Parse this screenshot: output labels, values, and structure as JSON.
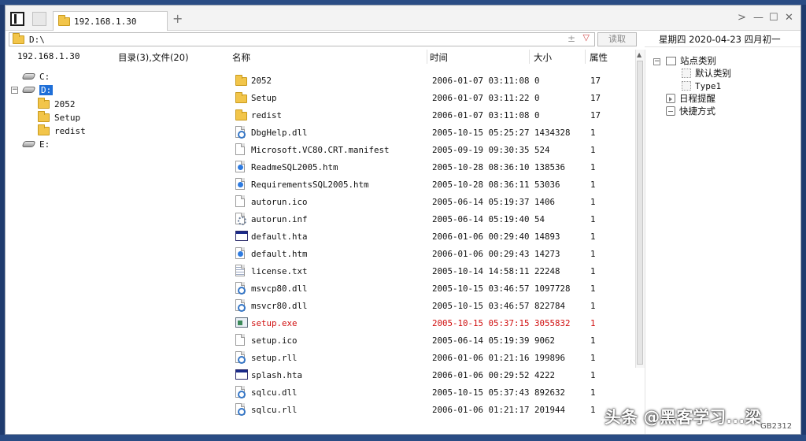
{
  "tab": {
    "label": "192.168.1.30"
  },
  "toolbar": {
    "new_tab": "+",
    "forward": ">",
    "minimize": "—",
    "maximize": "☐",
    "close": "✕"
  },
  "address": {
    "value": "D:\\",
    "add": "±",
    "dropdown": "▽",
    "read_button": "读取"
  },
  "date_bar": {
    "text": "星期四 2020-04-23  四月初一"
  },
  "left_pane": {
    "host": "192.168.1.30",
    "summary": "目录(3),文件(20)",
    "drives": [
      "C:",
      "D:",
      "E:"
    ],
    "d_folders": [
      "2052",
      "Setup",
      "redist"
    ]
  },
  "columns": {
    "name": "名称",
    "time": "时间",
    "size": "大小",
    "attr": "属性"
  },
  "files": [
    {
      "icon": "folder",
      "name": "2052",
      "time": "2006-01-07 03:11:08",
      "size": "0",
      "attr": "17"
    },
    {
      "icon": "folder",
      "name": "Setup",
      "time": "2006-01-07 03:11:22",
      "size": "0",
      "attr": "17"
    },
    {
      "icon": "folder",
      "name": "redist",
      "time": "2006-01-07 03:11:08",
      "size": "0",
      "attr": "17"
    },
    {
      "icon": "dll",
      "name": "DbgHelp.dll",
      "time": "2005-10-15 05:25:27",
      "size": "1434328",
      "attr": "1"
    },
    {
      "icon": "file",
      "name": "Microsoft.VC80.CRT.manifest",
      "time": "2005-09-19 09:30:35",
      "size": "524",
      "attr": "1"
    },
    {
      "icon": "htm",
      "name": "ReadmeSQL2005.htm",
      "time": "2005-10-28 08:36:10",
      "size": "138536",
      "attr": "1"
    },
    {
      "icon": "htm",
      "name": "RequirementsSQL2005.htm",
      "time": "2005-10-28 08:36:11",
      "size": "53036",
      "attr": "1"
    },
    {
      "icon": "file",
      "name": "autorun.ico",
      "time": "2005-06-14 05:19:37",
      "size": "1406",
      "attr": "1"
    },
    {
      "icon": "gear",
      "name": "autorun.inf",
      "time": "2005-06-14 05:19:40",
      "size": "54",
      "attr": "1"
    },
    {
      "icon": "app",
      "name": "default.hta",
      "time": "2006-01-06 00:29:40",
      "size": "14893",
      "attr": "1"
    },
    {
      "icon": "htm",
      "name": "default.htm",
      "time": "2006-01-06 00:29:43",
      "size": "14273",
      "attr": "1"
    },
    {
      "icon": "txt",
      "name": "license.txt",
      "time": "2005-10-14 14:58:11",
      "size": "22248",
      "attr": "1"
    },
    {
      "icon": "dll",
      "name": "msvcp80.dll",
      "time": "2005-10-15 03:46:57",
      "size": "1097728",
      "attr": "1"
    },
    {
      "icon": "dll",
      "name": "msvcr80.dll",
      "time": "2005-10-15 03:46:57",
      "size": "822784",
      "attr": "1"
    },
    {
      "icon": "exe",
      "name": "setup.exe",
      "time": "2005-10-15 05:37:15",
      "size": "3055832",
      "attr": "1",
      "highlight": true
    },
    {
      "icon": "file",
      "name": "setup.ico",
      "time": "2005-06-14 05:19:39",
      "size": "9062",
      "attr": "1"
    },
    {
      "icon": "dll",
      "name": "setup.rll",
      "time": "2006-01-06 01:21:16",
      "size": "199896",
      "attr": "1"
    },
    {
      "icon": "app",
      "name": "splash.hta",
      "time": "2006-01-06 00:29:52",
      "size": "4222",
      "attr": "1"
    },
    {
      "icon": "dll",
      "name": "sqlcu.dll",
      "time": "2005-10-15 05:37:43",
      "size": "892632",
      "attr": "1"
    },
    {
      "icon": "dll",
      "name": "sqlcu.rll",
      "time": "2006-01-06 01:21:17",
      "size": "201944",
      "attr": "1"
    }
  ],
  "right_pane": {
    "site_category": "站点类别",
    "default_category": "默认类别",
    "type1": "Type1",
    "schedule": "日程提醒",
    "shortcuts": "快捷方式"
  },
  "watermark": {
    "text": "头条 @黑客学习...梁",
    "sub": "GB2312"
  },
  "colors": {
    "selection": "#1f6fd8",
    "highlight_file": "#d01010",
    "folder": "#f2c54a"
  }
}
